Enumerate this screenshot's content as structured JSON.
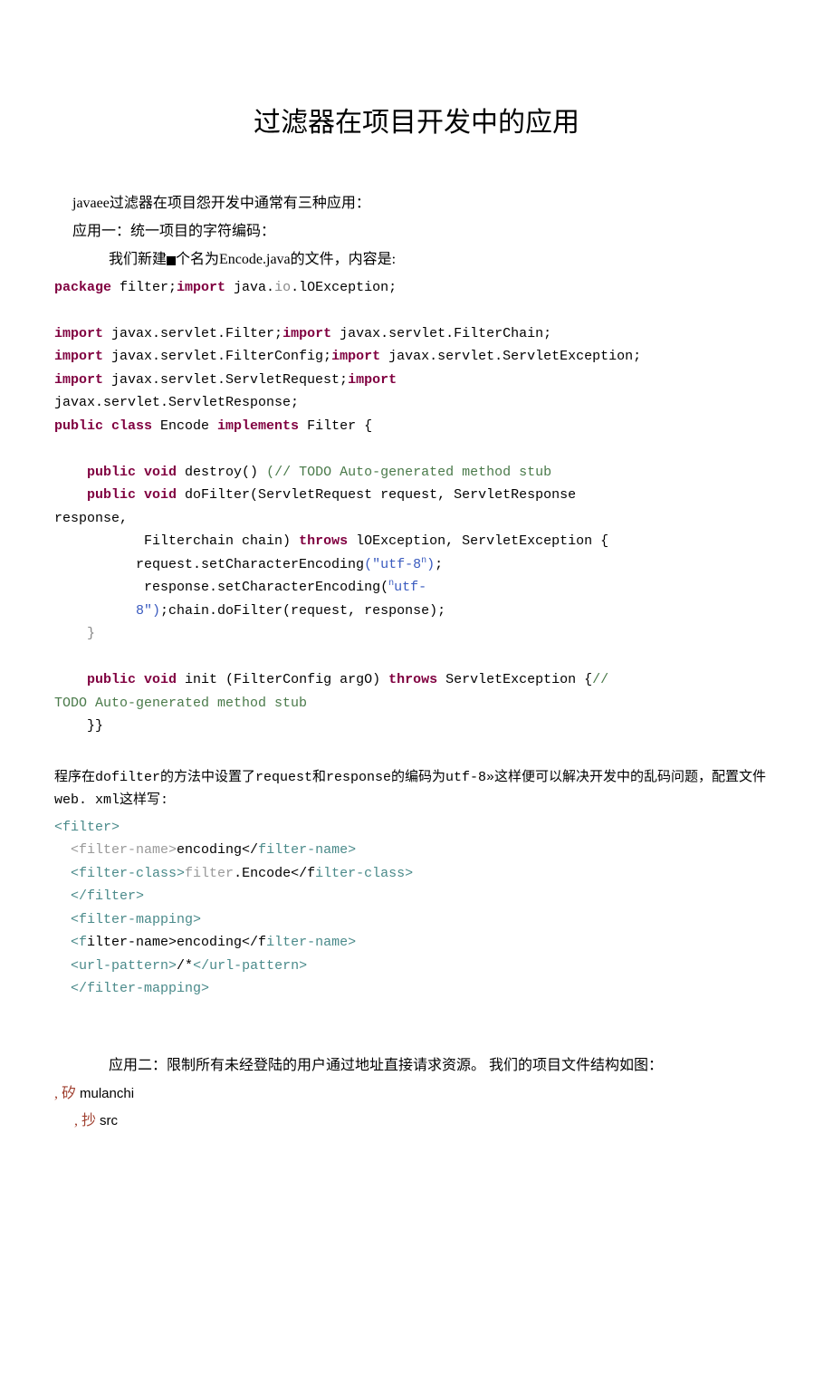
{
  "title": "过滤器在项目开发中的应用",
  "p1": "javaee过滤器在项目怨开发中通常有三种应用：",
  "p2": "应用一：统一项目的字符编码：",
  "p3": "我们新建",
  "p3b": "个名为Encode.java的文件，内容是:",
  "code1": {
    "l1a": "package",
    "l1b": " filter;",
    "l1c": "import",
    "l1d": " java.",
    "l1e": "io",
    "l1f": ".lOException;",
    "l2a": "import",
    "l2b": " javax.servlet.Filter;",
    "l2c": "import",
    "l2d": " javax.servlet.FilterChain;",
    "l3a": "import",
    "l3b": " javax.servlet.FilterConfig;",
    "l3c": "import",
    "l3d": " javax.servlet.ServletException;",
    "l4a": "import",
    "l4b": " javax.servlet.ServletRequest;",
    "l4c": "import",
    "l4d": "javax.servlet.ServletResponse;",
    "l5a": "public class",
    "l5b": " Encode ",
    "l5c": "implements",
    "l5d": " Filter {",
    "l6a": "public void",
    "l6b": " destroy() ",
    "l6c": "(",
    "l6d": "// TODO Auto-generated method stub",
    "l7a": "public void",
    "l7b": " doFilter(ServletRequest request, ServletResponse",
    "l7c": "response,",
    "l8a": "Filterchain chain) ",
    "l8b": "throws",
    "l8c": " lOException, ServletException {",
    "l9a": "request.setCharacterEncoding",
    "l9b": "(\"utf-8",
    "l9c": "n",
    "l9d": ")",
    "l9e": ";",
    "l10a": "response.setCharacterEncoding(",
    "l10b": "n",
    "l10c": "utf-",
    "l11a": "8\")",
    "l11b": ";chain.doFilter(request, response);",
    "l12": "}",
    "l13a": "public void",
    "l13b": " init (FilterConfig argO) ",
    "l13c": "throws",
    "l13d": " ServletException {",
    "l13e": "//",
    "l14": "TODO Auto-generated method stub",
    "l15": "}}"
  },
  "p4": "程序在dofilter的方法中设置了request和response的编码为utf-8»这样便可以解决开发中的乱码问题，配置文件web. xml这样写:",
  "xml": {
    "l1": "<filter>",
    "l2a": "<filter-name>",
    "l2b": "encoding</",
    "l2c": "filter-name>",
    "l3a": "<filter-class>",
    "l3b": "filter",
    "l3c": ".Encode</f",
    "l3d": "ilter-class>",
    "l4": "</filter>",
    "l5": "<filter-mapping>",
    "l6a": "<f",
    "l6b": "ilter-name>encoding</f",
    "l6c": "ilter-name>",
    "l7a": "<url-pattern>",
    "l7b": "/*",
    "l7c": "</url-pattern>",
    "l8": "</filter-mapping>"
  },
  "p5": "应用二：限制所有未经登陆的用户通过地址直接请求资源。 我们的项目文件结构如图：",
  "tree": {
    "l1a": ",  矽 ",
    "l1b": "mulanchi",
    "l2a": ",  抄 ",
    "l2b": "src"
  }
}
